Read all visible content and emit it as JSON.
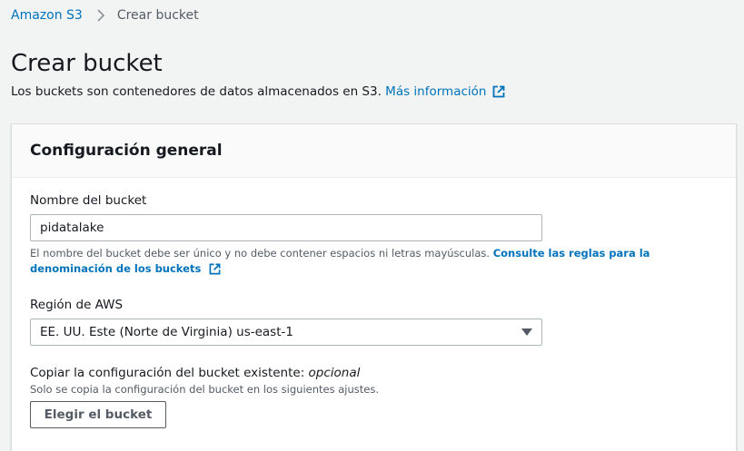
{
  "breadcrumb": {
    "items": [
      "Amazon S3",
      "Crear bucket"
    ]
  },
  "page": {
    "title": "Crear bucket",
    "description": "Los buckets son contenedores de datos almacenados en S3.",
    "more_info_link": "Más información"
  },
  "panel": {
    "title": "Configuración general",
    "bucket_name": {
      "label": "Nombre del bucket",
      "value": "pidatalake",
      "hint": "El nombre del bucket debe ser único y no debe contener espacios ni letras mayúsculas.",
      "hint_link": "Consulte las reglas para la denominación de los buckets"
    },
    "region": {
      "label": "Región de AWS",
      "selected": "EE. UU. Este (Norte de Virginia) us-east-1"
    },
    "copy_config": {
      "label": "Copiar la configuración del bucket existente:",
      "optional": "opcional",
      "hint": "Solo se copia la configuración del bucket en los siguientes ajustes.",
      "button_label": "Elegir el bucket"
    }
  },
  "icons": {
    "breadcrumb_separator": "chevron-right-icon",
    "external_link": "external-link-icon",
    "dropdown": "caret-down-icon"
  },
  "colors": {
    "link": "#0073bb",
    "background": "#f2f3f3",
    "text": "#16191f",
    "secondary_text": "#545b64"
  }
}
